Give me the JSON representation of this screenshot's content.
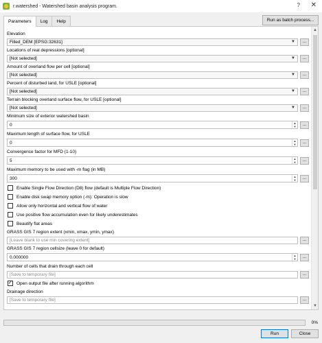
{
  "window": {
    "title": "r.watershed - Watershed basin analysis program.",
    "help_label": "?",
    "close_label": "✕"
  },
  "tabs": [
    {
      "label": "Parameters",
      "active": true
    },
    {
      "label": "Log",
      "active": false
    },
    {
      "label": "Help",
      "active": false
    }
  ],
  "batch_button": "Run as batch process...",
  "dots_label": "...",
  "fields": {
    "elevation": {
      "label": "Elevation",
      "value": "Filled_DEM [EPSG:32631]"
    },
    "depressions": {
      "label": "Locations of real depressions [optional]",
      "value": "[Not selected]"
    },
    "overland_flow": {
      "label": "Amount of overland flow per cell [optional]",
      "value": "[Not selected]"
    },
    "disturbed_land": {
      "label": "Percent of disturbed land, for USLE [optional]",
      "value": "[Not selected]"
    },
    "blocking": {
      "label": "Terrain blocking overland surface flow, for USLE [optional]",
      "value": "[Not selected]"
    },
    "threshold": {
      "label": "Minimum size of exterior watershed basin",
      "value": "0"
    },
    "max_slope_length": {
      "label": "Maximum length of surface flow, for USLE",
      "value": "0"
    },
    "convergence": {
      "label": "Convergence factor for MFD (1-10)",
      "value": "5"
    },
    "memory": {
      "label": "Maximum memory to be used with -m flag (in MB)",
      "value": "300"
    },
    "region_extent": {
      "label": "GRASS GIS 7 region extent (xmin, xmax, ymin, ymax)",
      "placeholder": "[Leave blank to use min covering extent]"
    },
    "region_cellsize": {
      "label": "GRASS GIS 7 region cellsize (leave 0 for default)",
      "value": "0.000000"
    },
    "accumulation": {
      "label": "Number of cells that drain through each cell",
      "placeholder": "[Save to temporary file]"
    },
    "drainage": {
      "label": "Drainage direction",
      "placeholder": "[Save to temporary file]"
    }
  },
  "checkboxes": [
    {
      "label": "Enable Single Flow Direction (D8) flow (default is Multiple Flow Direction)",
      "checked": false
    },
    {
      "label": "Enable disk swap memory option (-m): Operation is slow",
      "checked": false
    },
    {
      "label": "Allow only horizontal and vertical flow of water",
      "checked": false
    },
    {
      "label": "Use positive flow accumulation even for likely underestimates",
      "checked": false
    },
    {
      "label": "Beautify flat areas",
      "checked": false
    }
  ],
  "open_output": {
    "label": "Open output file after running algorithm",
    "checked": true
  },
  "progress": {
    "value": 0,
    "text": "0%"
  },
  "buttons": {
    "run": "Run",
    "close": "Close"
  },
  "icons": {
    "app": "qgis-processing-icon",
    "dropdown": "chevron-down-icon",
    "spin": "spin-arrows-icon"
  }
}
